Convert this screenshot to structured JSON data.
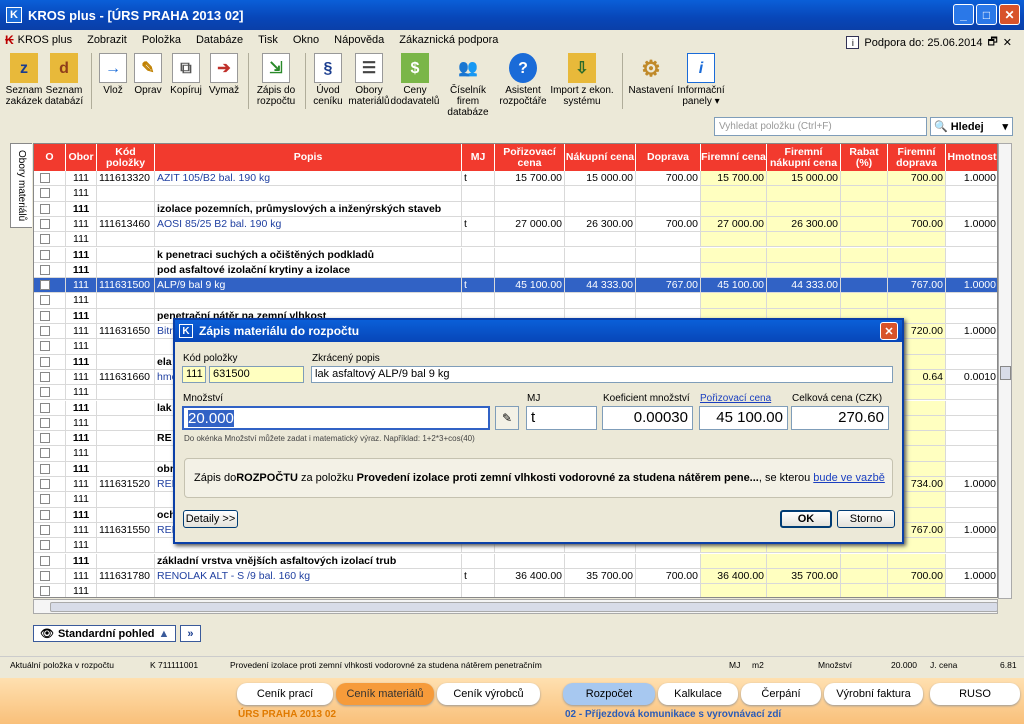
{
  "window": {
    "title": "KROS plus  - [ÚRS PRAHA 2013 02]"
  },
  "menu": {
    "items": [
      "KROS plus",
      "Zobrazit",
      "Položka",
      "Databáze",
      "Tisk",
      "Okno",
      "Nápověda",
      "Zákaznická podpora"
    ],
    "support": "Podpora do: 25.06.2014"
  },
  "toolbar": [
    {
      "label": "Seznam zakázek",
      "icon": "z-folder-icon"
    },
    {
      "label": "Seznam databází",
      "icon": "d-folder-icon"
    },
    {
      "label": "Vlož",
      "icon": "insert-doc-icon"
    },
    {
      "label": "Oprav",
      "icon": "edit-doc-icon"
    },
    {
      "label": "Kopíruj",
      "icon": "copy-doc-icon"
    },
    {
      "label": "Vymaž",
      "icon": "delete-doc-icon"
    },
    {
      "label": "Zápis do rozpočtu",
      "icon": "write-budget-icon"
    },
    {
      "label": "Úvod ceníku",
      "icon": "pricelist-icon"
    },
    {
      "label": "Obory materiálů",
      "icon": "materials-icon"
    },
    {
      "label": "Ceny dodavatelů",
      "icon": "supplier-prices-icon"
    },
    {
      "label": "Číselník firem databáze",
      "icon": "companies-icon"
    },
    {
      "label": "Asistent rozpočtáře",
      "icon": "assistant-icon"
    },
    {
      "label": "Import z ekon. systému",
      "icon": "import-icon"
    },
    {
      "label": "Nastavení",
      "icon": "gear-icon"
    },
    {
      "label": "Informační panely ▾",
      "icon": "info-icon"
    }
  ],
  "search": {
    "placeholder": "Vyhledat položku (Ctrl+F)",
    "button": "Hledej"
  },
  "sidetab": "Obory materiálů",
  "table": {
    "columns": [
      "O",
      "Obor",
      "Kód položky",
      "Popis",
      "MJ",
      "Pořizovací cena",
      "Nákupní cena",
      "Doprava",
      "Firemní cena",
      "Firemní nákupní cena",
      "Rabat (%)",
      "Firemní doprava",
      "Hmotnost"
    ],
    "rows": [
      {
        "obor": "111",
        "kod": "111613320",
        "popis": "AZIT 105/B2  bal. 190 kg",
        "mj": "t",
        "por": "15 700.00",
        "nak": "15 000.00",
        "dop": "700.00",
        "fc": "15 700.00",
        "fnc": "15 000.00",
        "rab": "",
        "fd": "700.00",
        "hm": "1.0000",
        "bold": false
      },
      {
        "obor": "111",
        "kod": "",
        "popis": "",
        "mj": "",
        "por": "",
        "nak": "",
        "dop": "",
        "fc": "",
        "fnc": "",
        "rab": "",
        "fd": "",
        "hm": "",
        "bold": false
      },
      {
        "obor": "111",
        "kod": "",
        "popis": "izolace pozemních, průmyslových a inženýrských staveb",
        "mj": "",
        "por": "",
        "nak": "",
        "dop": "",
        "fc": "",
        "fnc": "",
        "rab": "",
        "fd": "",
        "hm": "",
        "bold": true
      },
      {
        "obor": "111",
        "kod": "111613460",
        "popis": "AOSI 85/25 B2 bal. 190 kg",
        "mj": "t",
        "por": "27 000.00",
        "nak": "26 300.00",
        "dop": "700.00",
        "fc": "27 000.00",
        "fnc": "26 300.00",
        "rab": "",
        "fd": "700.00",
        "hm": "1.0000",
        "bold": false
      },
      {
        "obor": "111",
        "kod": "",
        "popis": "",
        "mj": "",
        "por": "",
        "nak": "",
        "dop": "",
        "fc": "",
        "fnc": "",
        "rab": "",
        "fd": "",
        "hm": "",
        "bold": false
      },
      {
        "obor": "111",
        "kod": "",
        "popis": "k penetraci suchých a očištěných podkladů",
        "mj": "",
        "por": "",
        "nak": "",
        "dop": "",
        "fc": "",
        "fnc": "",
        "rab": "",
        "fd": "",
        "hm": "",
        "bold": true
      },
      {
        "obor": "111",
        "kod": "",
        "popis": " pod asfaltové izolační krytiny a izolace",
        "mj": "",
        "por": "",
        "nak": "",
        "dop": "",
        "fc": "",
        "fnc": "",
        "rab": "",
        "fd": "",
        "hm": "",
        "bold": true
      },
      {
        "obor": "111",
        "kod": "111631500",
        "popis": "ALP/9 bal 9 kg",
        "mj": "t",
        "por": "45 100.00",
        "nak": "44 333.00",
        "dop": "767.00",
        "fc": "45 100.00",
        "fnc": "44 333.00",
        "rab": "",
        "fd": "767.00",
        "hm": "1.0000",
        "bold": false,
        "sel": true
      },
      {
        "obor": "111",
        "kod": "",
        "popis": "",
        "mj": "",
        "por": "",
        "nak": "",
        "dop": "",
        "fc": "",
        "fnc": "",
        "rab": "",
        "fd": "",
        "hm": "",
        "bold": false
      },
      {
        "obor": "111",
        "kod": "",
        "popis": "penetrační nátěr na zemní vlhkost",
        "mj": "",
        "por": "",
        "nak": "",
        "dop": "",
        "fc": "",
        "fnc": "",
        "rab": "",
        "fd": "",
        "hm": "",
        "bold": true
      },
      {
        "obor": "111",
        "kod": "111631650",
        "popis": "Bitr",
        "mj": "",
        "por": "",
        "nak": "",
        "dop": "",
        "fc": "",
        "fnc": "",
        "rab": "",
        "fd": "720.00",
        "hm": "1.0000",
        "bold": false
      },
      {
        "obor": "111",
        "kod": "",
        "popis": "",
        "mj": "",
        "por": "",
        "nak": "",
        "dop": "",
        "fc": "",
        "fnc": "",
        "rab": "",
        "fd": "",
        "hm": "",
        "bold": false
      },
      {
        "obor": "111",
        "kod": "",
        "popis": "ela",
        "mj": "",
        "por": "",
        "nak": "",
        "dop": "",
        "fc": "",
        "fnc": "",
        "rab": "",
        "fd": "",
        "hm": "",
        "bold": true
      },
      {
        "obor": "111",
        "kod": "111631660",
        "popis": "hmo",
        "mj": "",
        "por": "",
        "nak": "",
        "dop": "",
        "fc": "",
        "fnc": "",
        "rab": "",
        "fd": "0.64",
        "hm": "0.0010",
        "bold": false
      },
      {
        "obor": "111",
        "kod": "",
        "popis": "",
        "mj": "",
        "por": "",
        "nak": "",
        "dop": "",
        "fc": "",
        "fnc": "",
        "rab": "",
        "fd": "",
        "hm": "",
        "bold": false
      },
      {
        "obor": "111",
        "kod": "",
        "popis": "lak",
        "mj": "",
        "por": "",
        "nak": "",
        "dop": "",
        "fc": "",
        "fnc": "",
        "rab": "",
        "fd": "",
        "hm": "",
        "bold": true
      },
      {
        "obor": "111",
        "kod": "",
        "popis": "",
        "mj": "",
        "por": "",
        "nak": "",
        "dop": "",
        "fc": "",
        "fnc": "",
        "rab": "",
        "fd": "",
        "hm": "",
        "bold": false
      },
      {
        "obor": "111",
        "kod": "",
        "popis": "RE",
        "mj": "",
        "por": "",
        "nak": "",
        "dop": "",
        "fc": "",
        "fnc": "",
        "rab": "",
        "fd": "",
        "hm": "",
        "bold": true
      },
      {
        "obor": "111",
        "kod": "",
        "popis": "",
        "mj": "",
        "por": "",
        "nak": "",
        "dop": "",
        "fc": "",
        "fnc": "",
        "rab": "",
        "fd": "",
        "hm": "",
        "bold": false
      },
      {
        "obor": "111",
        "kod": "",
        "popis": "obr",
        "mj": "",
        "por": "",
        "nak": "",
        "dop": "",
        "fc": "",
        "fnc": "",
        "rab": "",
        "fd": "",
        "hm": "",
        "bold": true
      },
      {
        "obor": "111",
        "kod": "111631520",
        "popis": "REN",
        "mj": "",
        "por": "",
        "nak": "",
        "dop": "",
        "fc": "",
        "fnc": "",
        "rab": "",
        "fd": "734.00",
        "hm": "1.0000",
        "bold": false
      },
      {
        "obor": "111",
        "kod": "",
        "popis": "",
        "mj": "",
        "por": "",
        "nak": "",
        "dop": "",
        "fc": "",
        "fnc": "",
        "rab": "",
        "fd": "",
        "hm": "",
        "bold": false
      },
      {
        "obor": "111",
        "kod": "",
        "popis": "och",
        "mj": "",
        "por": "",
        "nak": "",
        "dop": "",
        "fc": "",
        "fnc": "",
        "rab": "",
        "fd": "",
        "hm": "",
        "bold": true
      },
      {
        "obor": "111",
        "kod": "111631550",
        "popis": "REN",
        "mj": "",
        "por": "",
        "nak": "",
        "dop": "",
        "fc": "",
        "fnc": "",
        "rab": "",
        "fd": "767.00",
        "hm": "1.0000",
        "bold": false
      },
      {
        "obor": "111",
        "kod": "",
        "popis": "",
        "mj": "",
        "por": "",
        "nak": "",
        "dop": "",
        "fc": "",
        "fnc": "",
        "rab": "",
        "fd": "",
        "hm": "",
        "bold": false
      },
      {
        "obor": "111",
        "kod": "",
        "popis": "základní vrstva vnějších asfaltových izolací trub",
        "mj": "",
        "por": "",
        "nak": "",
        "dop": "",
        "fc": "",
        "fnc": "",
        "rab": "",
        "fd": "",
        "hm": "",
        "bold": true
      },
      {
        "obor": "111",
        "kod": "111631780",
        "popis": "RENOLAK ALT - S /9    bal. 160 kg",
        "mj": "t",
        "por": "36 400.00",
        "nak": "35 700.00",
        "dop": "700.00",
        "fc": "36 400.00",
        "fnc": "35 700.00",
        "rab": "",
        "fd": "700.00",
        "hm": "1.0000",
        "bold": false
      },
      {
        "obor": "111",
        "kod": "",
        "popis": "",
        "mj": "",
        "por": "",
        "nak": "",
        "dop": "",
        "fc": "",
        "fnc": "",
        "rab": "",
        "fd": "",
        "hm": "",
        "bold": false
      }
    ]
  },
  "viewbar": {
    "label": "Standardní pohled",
    "next": "»"
  },
  "status": {
    "label": "Aktuální položka v rozpočtu",
    "code": "K  711111001",
    "desc": "Provedení izolace proti zemní vlhkosti vodorovné za studena nátěrem penetračním",
    "mj_label": "MJ",
    "mj": "m2",
    "qty_label": "Množství",
    "qty": "20.000",
    "price_label": "J. cena",
    "price": "6.81"
  },
  "bottom": {
    "tabs": [
      "Ceník prací",
      "Ceník materiálů",
      "Ceník výrobců",
      "Rozpočet",
      "Kalkulace",
      "Čerpání",
      "Výrobní faktura",
      "RUSO"
    ],
    "left": "ÚRS PRAHA 2013 02",
    "right": "02 - Příjezdová komunikace s vyrovnávací zdí"
  },
  "dialog": {
    "title": "Zápis materiálu do rozpočtu",
    "kod_label": "Kód položky",
    "obor": "111",
    "kod": "631500",
    "popis_label": "Zkrácený popis",
    "popis": "lak asfaltový ALP/9 bal 9 kg",
    "mnozstvi_label": "Množství",
    "mnozstvi": "20.000",
    "mj_label": "MJ",
    "mj": "t",
    "koef_label": "Koeficient množství",
    "koef": "0.00030",
    "cena_label": "Pořizovací cena",
    "cena": "45 100.00",
    "celkova_label": "Celková cena (CZK)",
    "celkova": "270.60",
    "hint": "Do okénka Množství můžete zadat i matematický výraz. Například: 1+2*3+cos(40)",
    "msg_pre": "Zápis do ",
    "msg_b1": "ROZPOČTU",
    "msg_mid": " za položku ",
    "msg_b2": "Provedení izolace proti zemní vlhkosti vodorovné za studena nátěrem pene...",
    "msg_post": ", se kterou ",
    "msg_link": "bude ve vazbě",
    "details": "Detaily >>",
    "ok": "OK",
    "cancel": "Storno"
  }
}
